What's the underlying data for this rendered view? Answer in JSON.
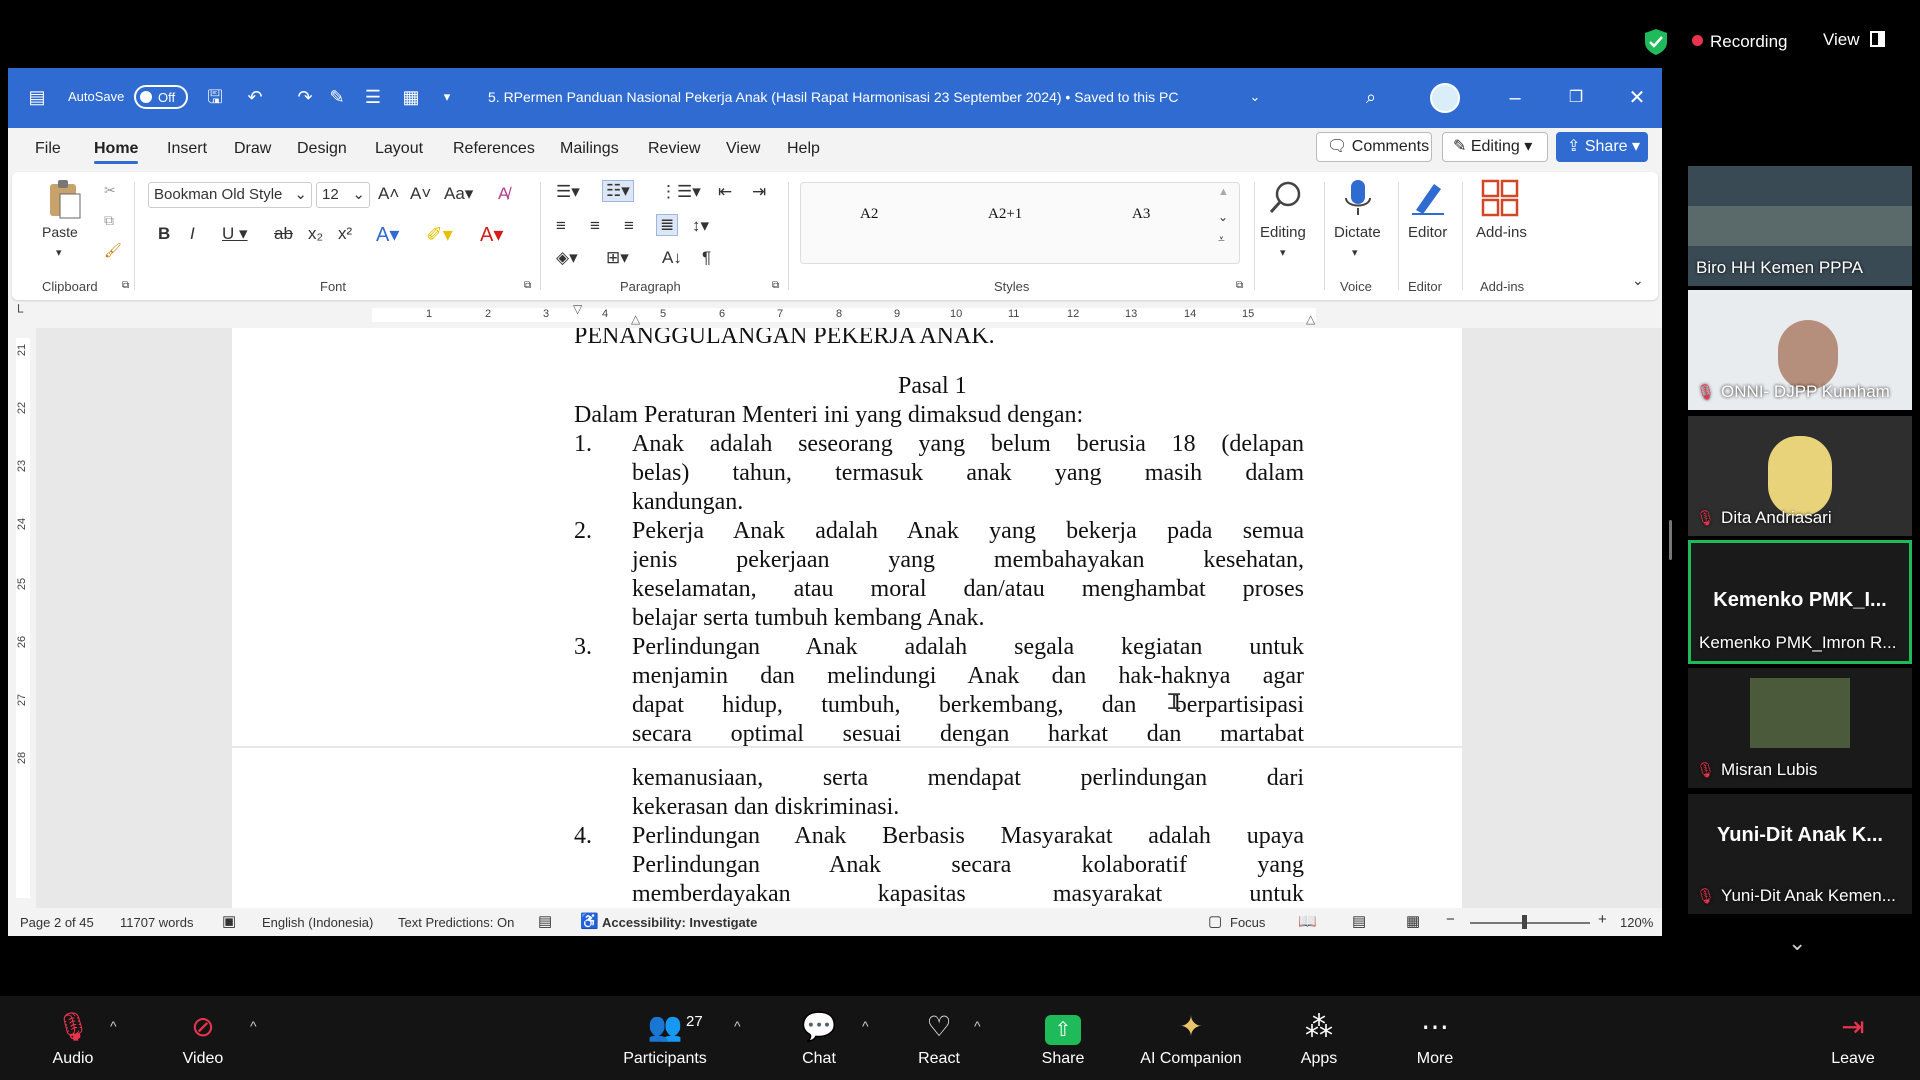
{
  "zoom": {
    "recording_label": "Recording",
    "view_label": "View",
    "toolbar": {
      "audio": "Audio",
      "video": "Video",
      "participants": "Participants",
      "participants_count": "27",
      "chat": "Chat",
      "react": "React",
      "share": "Share",
      "ai_companion": "AI Companion",
      "apps": "Apps",
      "more": "More",
      "leave": "Leave"
    },
    "participants": [
      {
        "name": "Biro HH Kemen PPPA",
        "muted": false
      },
      {
        "name": "ONNI- DJPP Kumham",
        "muted": true
      },
      {
        "name": "Dita Andriasari",
        "muted": true
      },
      {
        "name": "Kemenko PMK_Imron R...",
        "big": "Kemenko PMK_I...",
        "muted": false,
        "active": true
      },
      {
        "name": "Misran Lubis",
        "muted": true
      },
      {
        "name": "Yuni-Dit Anak Kemen...",
        "big": "Yuni-Dit Anak K...",
        "muted": true
      }
    ]
  },
  "word": {
    "autosave_label": "AutoSave",
    "autosave_state": "Off",
    "title": "5. RPermen Panduan Nasional Pekerja Anak (Hasil Rapat Harmonisasi 23 September 2024) • Saved to this PC",
    "menu": [
      "File",
      "Home",
      "Insert",
      "Draw",
      "Design",
      "Layout",
      "References",
      "Mailings",
      "Review",
      "View",
      "Help"
    ],
    "active_menu": "Home",
    "comments_label": "Comments",
    "editing_label": "Editing",
    "share_label": "Share",
    "ribbon": {
      "paste_label": "Paste",
      "font_name": "Bookman Old Style",
      "font_size": "12",
      "styles": [
        "A2",
        "A2+1",
        "A3"
      ],
      "editing": "Editing",
      "dictate": "Dictate",
      "editor": "Editor",
      "addins": "Add-ins",
      "groups": {
        "clipboard": "Clipboard",
        "font": "Font",
        "paragraph": "Paragraph",
        "styles": "Styles",
        "voice": "Voice",
        "editor": "Editor",
        "addins": "Add-ins"
      }
    },
    "ruler_numbers": [
      "1",
      "2",
      "3",
      "4",
      "5",
      "6",
      "7",
      "8",
      "9",
      "10",
      "11",
      "12",
      "13",
      "14",
      "15"
    ],
    "vruler_numbers": [
      "21",
      "22",
      "23",
      "24",
      "25",
      "26",
      "27",
      "28"
    ],
    "document": {
      "top_heading": "PENANGGULANGAN PEKERJA ANAK.",
      "pasal": "Pasal 1",
      "intro": "Dalam Peraturan Menteri ini yang dimaksud dengan:",
      "items": [
        {
          "num": "1.",
          "lines": [
            "Anak adalah seseorang yang belum berusia 18 (delapan",
            "belas) tahun, termasuk anak yang masih dalam",
            "kandungan."
          ]
        },
        {
          "num": "2.",
          "lines": [
            "Pekerja Anak adalah Anak yang bekerja pada semua",
            "jenis pekerjaan yang membahayakan kesehatan,",
            "keselamatan, atau moral dan/atau menghambat proses",
            "belajar serta tumbuh kembang Anak."
          ]
        },
        {
          "num": "3.",
          "lines": [
            "Perlindungan Anak adalah segala kegiatan untuk",
            "menjamin dan melindungi Anak dan hak-haknya agar",
            "dapat hidup, tumbuh, berkembang, dan berpartisipasi",
            "secara optimal sesuai dengan harkat dan martabat"
          ]
        },
        {
          "num": "",
          "lines": [
            "kemanusiaan, serta mendapat perlindungan dari",
            "kekerasan dan diskriminasi."
          ]
        },
        {
          "num": "4.",
          "lines": [
            "Perlindungan Anak Berbasis Masyarakat adalah upaya",
            "Perlindungan Anak secara kolaboratif yang",
            "memberdayakan kapasitas masyarakat untuk"
          ]
        }
      ]
    },
    "status": {
      "page": "Page 2 of 45",
      "words": "11707 words",
      "language": "English (Indonesia)",
      "predictions": "Text Predictions: On",
      "accessibility": "Accessibility: Investigate",
      "focus": "Focus",
      "zoom": "120%"
    }
  }
}
